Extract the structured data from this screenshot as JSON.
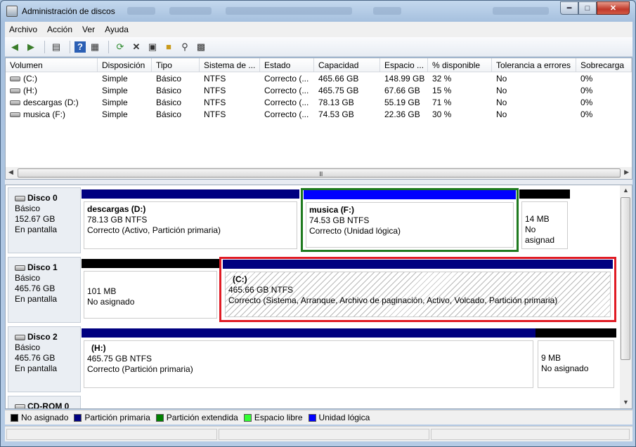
{
  "window": {
    "title": "Administración de discos"
  },
  "menu": [
    "Archivo",
    "Acción",
    "Ver",
    "Ayuda"
  ],
  "colors": {
    "no_asignado": "#000000",
    "particion_primaria": "#000080",
    "particion_extendida": "#008000",
    "espacio_libre": "#33ff33",
    "unidad_logica": "#0000ff",
    "selection_red": "#e01b24",
    "extended_green": "#1f7a1f"
  },
  "volumes": {
    "columns": [
      "Volumen",
      "Disposición",
      "Tipo",
      "Sistema de ...",
      "Estado",
      "Capacidad",
      "Espacio ...",
      "% disponible",
      "Tolerancia a errores",
      "Sobrecarga"
    ],
    "rows": [
      [
        "(C:)",
        "Simple",
        "Básico",
        "NTFS",
        "Correcto (...",
        "465.66 GB",
        "148.99 GB",
        "32 %",
        "No",
        "0%"
      ],
      [
        "(H:)",
        "Simple",
        "Básico",
        "NTFS",
        "Correcto (...",
        "465.75 GB",
        "67.66 GB",
        "15 %",
        "No",
        "0%"
      ],
      [
        "descargas (D:)",
        "Simple",
        "Básico",
        "NTFS",
        "Correcto (...",
        "78.13 GB",
        "55.19 GB",
        "71 %",
        "No",
        "0%"
      ],
      [
        "musica (F:)",
        "Simple",
        "Básico",
        "NTFS",
        "Correcto (...",
        "74.53 GB",
        "22.36 GB",
        "30 %",
        "No",
        "0%"
      ]
    ]
  },
  "disks": [
    {
      "name": "Disco 0",
      "type": "Básico",
      "size": "152.67 GB",
      "status": "En pantalla",
      "partitions": [
        {
          "title": "descargas  (D:)",
          "size": "78.13 GB NTFS",
          "status": "Correcto (Activo, Partición primaria)"
        },
        {
          "title": "musica  (F:)",
          "size": "74.53 GB NTFS",
          "status": "Correcto (Unidad lógica)"
        },
        {
          "title": "",
          "size": "14 MB",
          "status": "No asignad"
        }
      ]
    },
    {
      "name": "Disco 1",
      "type": "Básico",
      "size": "465.76 GB",
      "status": "En pantalla",
      "partitions": [
        {
          "title": "",
          "size": "101 MB",
          "status": "No asignado"
        },
        {
          "title": "(C:)",
          "size": "465.66 GB NTFS",
          "status": "Correcto (Sistema, Arranque, Archivo de paginación, Activo, Volcado, Partición primaria)"
        }
      ]
    },
    {
      "name": "Disco 2",
      "type": "Básico",
      "size": "465.76 GB",
      "status": "En pantalla",
      "partitions": [
        {
          "title": "(H:)",
          "size": "465.75 GB NTFS",
          "status": "Correcto (Partición primaria)"
        },
        {
          "title": "",
          "size": "9 MB",
          "status": "No asignado"
        }
      ]
    },
    {
      "name": "CD-ROM 0"
    }
  ],
  "legend": [
    "No asignado",
    "Partición primaria",
    "Partición extendida",
    "Espacio libre",
    "Unidad lógica"
  ],
  "scrollbar": {
    "grip": "III"
  }
}
